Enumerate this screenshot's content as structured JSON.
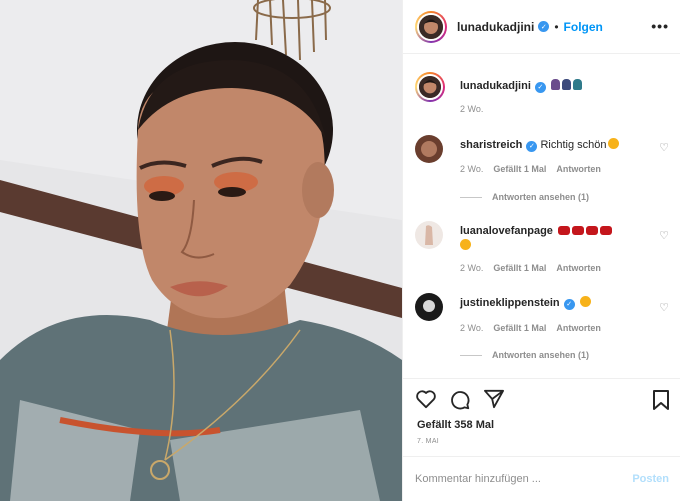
{
  "post": {
    "author": "lunadukadjini",
    "follow_label": "Folgen",
    "separator": "•",
    "more_label": "•••",
    "caption_time": "2 Wo.",
    "likes": "Gefällt 358 Mal",
    "date": "7. MAI",
    "comment_placeholder": "Kommentar hinzufügen ...",
    "post_label": "Posten"
  },
  "comments": [
    {
      "user": "sharistreich",
      "text": "Richtig schön",
      "time": "2 Wo.",
      "likes": "Gefällt 1 Mal",
      "reply_label": "Antworten",
      "view_replies": "Antworten ansehen (1)",
      "verified": true
    },
    {
      "user": "luanalovefanpage",
      "text": "",
      "time": "2 Wo.",
      "likes": "Gefällt 1 Mal",
      "reply_label": "Antworten",
      "verified": false
    },
    {
      "user": "justineklippenstein",
      "text": "",
      "time": "2 Wo.",
      "likes": "Gefällt 1 Mal",
      "reply_label": "Antworten",
      "view_replies": "Antworten ansehen (1)",
      "verified": true
    }
  ],
  "icons": {
    "like": "heart-icon",
    "comment": "comment-icon",
    "share": "paper-plane-icon",
    "save": "bookmark-icon",
    "verified": "verified-badge-icon",
    "comment_like": "small-heart-icon"
  },
  "colors": {
    "accent": "#0095f6",
    "verified": "#3897f0",
    "muted": "#8e8e8e",
    "post_disabled": "#b2dffc",
    "border": "#efefef"
  }
}
